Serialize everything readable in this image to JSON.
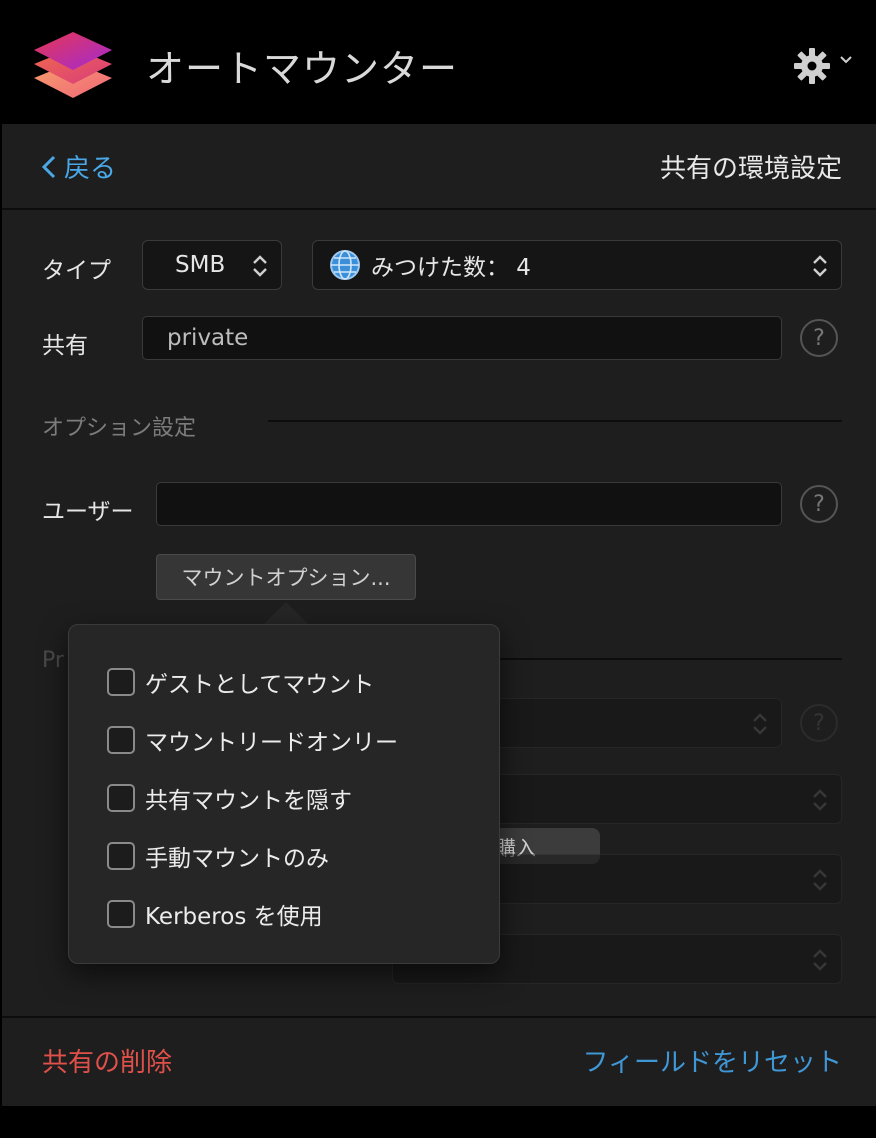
{
  "app": {
    "title": "オートマウンター",
    "logo_icon": "layers-icon",
    "settings_icon": "gear-icon"
  },
  "nav": {
    "back_label": "戻る",
    "page_title": "共有の環境設定"
  },
  "form": {
    "type_label": "タイプ",
    "type_value": "SMB",
    "found_label": "みつけた数： 4",
    "share_label": "共有",
    "share_value": "private",
    "options_section": "オプション設定",
    "user_label": "ユーザー",
    "user_value": "",
    "mount_options_button": "マウントオプション..."
  },
  "background": {
    "section_fragment": "Pr",
    "buy_badge": "購入"
  },
  "popover": {
    "options": [
      {
        "label": "ゲストとしてマウント",
        "checked": false
      },
      {
        "label": "マウントリードオンリー",
        "checked": false
      },
      {
        "label": "共有マウントを隠す",
        "checked": false
      },
      {
        "label": "手動マウントのみ",
        "checked": false
      },
      {
        "label": "Kerberos を使用",
        "checked": false
      }
    ]
  },
  "footer": {
    "delete_label": "共有の削除",
    "reset_label": "フィールドをリセット"
  },
  "colors": {
    "accent_blue": "#4aa8e8",
    "danger_red": "#e0504a",
    "panel_bg": "#1e1e1e"
  }
}
